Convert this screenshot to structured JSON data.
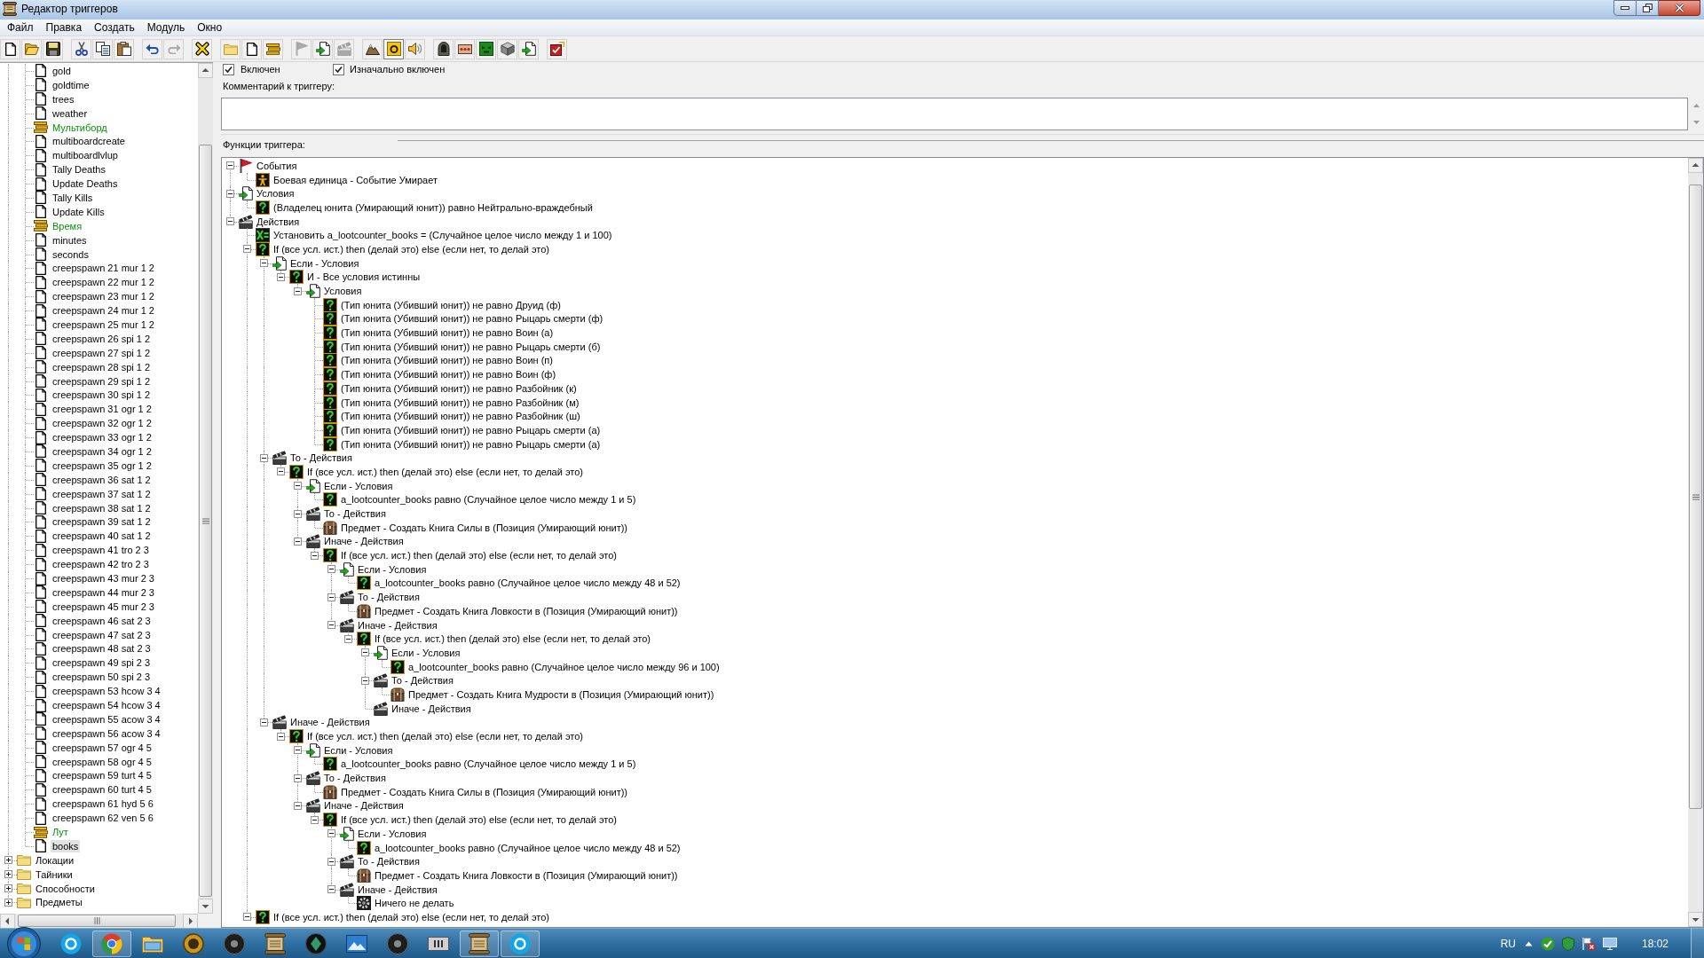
{
  "window": {
    "title": "Редактор триггеров"
  },
  "menu": [
    "Файл",
    "Правка",
    "Создать",
    "Модуль",
    "Окно"
  ],
  "toolbar": {
    "groups": [
      [
        {
          "kind": "new",
          "disabled": false,
          "pressed": false
        },
        {
          "kind": "open",
          "disabled": false,
          "pressed": false
        },
        {
          "kind": "save",
          "disabled": false,
          "pressed": false
        }
      ],
      [
        {
          "kind": "cut",
          "disabled": false,
          "pressed": false
        },
        {
          "kind": "copy",
          "disabled": false,
          "pressed": false
        },
        {
          "kind": "paste",
          "disabled": false,
          "pressed": false
        }
      ],
      [
        {
          "kind": "undo",
          "disabled": false,
          "pressed": false
        },
        {
          "kind": "redo",
          "disabled": true,
          "pressed": false
        }
      ],
      [
        {
          "kind": "delete",
          "disabled": false,
          "pressed": false
        }
      ],
      [
        {
          "kind": "new-category",
          "disabled": false,
          "pressed": false
        },
        {
          "kind": "new-trigger",
          "disabled": false,
          "pressed": false
        },
        {
          "kind": "new-comment",
          "disabled": false,
          "pressed": false
        }
      ],
      [
        {
          "kind": "new-event",
          "disabled": true,
          "pressed": false
        },
        {
          "kind": "new-condition",
          "disabled": false,
          "pressed": false
        },
        {
          "kind": "new-action",
          "disabled": true,
          "pressed": false
        }
      ],
      [
        {
          "kind": "terrain",
          "disabled": false,
          "pressed": false
        },
        {
          "kind": "object",
          "disabled": false,
          "pressed": true
        },
        {
          "kind": "sound",
          "disabled": false,
          "pressed": false
        }
      ],
      [
        {
          "kind": "unit",
          "disabled": false,
          "pressed": false
        },
        {
          "kind": "item",
          "disabled": false,
          "pressed": false
        },
        {
          "kind": "ai",
          "disabled": false,
          "pressed": false
        },
        {
          "kind": "import",
          "disabled": false,
          "pressed": false
        },
        {
          "kind": "manager",
          "disabled": false,
          "pressed": false
        }
      ],
      [
        {
          "kind": "test",
          "disabled": false,
          "pressed": false
        }
      ]
    ]
  },
  "sidebar": {
    "tree": [
      {
        "children": [
          {
            "kind": "trigger",
            "label": "gold",
            "selected": false
          },
          {
            "kind": "trigger",
            "label": "goldtime",
            "selected": false
          },
          {
            "kind": "trigger",
            "label": "trees",
            "selected": false
          },
          {
            "kind": "trigger",
            "label": "weather",
            "selected": false
          },
          {
            "kind": "category",
            "label": "Мультиборд",
            "selected": false
          },
          {
            "kind": "trigger",
            "label": "multiboardcreate",
            "selected": false
          },
          {
            "kind": "trigger",
            "label": "multiboardlvlup",
            "selected": false
          },
          {
            "kind": "trigger",
            "label": "Tally Deaths",
            "selected": false
          },
          {
            "kind": "trigger",
            "label": "Update Deaths",
            "selected": false
          },
          {
            "kind": "trigger",
            "label": "Tally Kills",
            "selected": false
          },
          {
            "kind": "trigger",
            "label": "Update Kills",
            "selected": false
          },
          {
            "kind": "category",
            "label": "Время",
            "selected": false
          },
          {
            "kind": "trigger",
            "label": "minutes",
            "selected": false
          },
          {
            "kind": "trigger",
            "label": "seconds",
            "selected": false
          },
          {
            "kind": "trigger",
            "label": "creepspawn 21 mur 1 2",
            "selected": false
          },
          {
            "kind": "trigger",
            "label": "creepspawn 22 mur 1 2",
            "selected": false
          },
          {
            "kind": "trigger",
            "label": "creepspawn 23 mur 1 2",
            "selected": false
          },
          {
            "kind": "trigger",
            "label": "creepspawn 24 mur 1 2",
            "selected": false
          },
          {
            "kind": "trigger",
            "label": "creepspawn 25 mur 1 2",
            "selected": false
          },
          {
            "kind": "trigger",
            "label": "creepspawn 26 spi 1 2",
            "selected": false
          },
          {
            "kind": "trigger",
            "label": "creepspawn 27 spi 1 2",
            "selected": false
          },
          {
            "kind": "trigger",
            "label": "creepspawn 28 spi 1 2",
            "selected": false
          },
          {
            "kind": "trigger",
            "label": "creepspawn 29 spi 1 2",
            "selected": false
          },
          {
            "kind": "trigger",
            "label": "creepspawn 30 spi 1 2",
            "selected": false
          },
          {
            "kind": "trigger",
            "label": "creepspawn 31 ogr 1 2",
            "selected": false
          },
          {
            "kind": "trigger",
            "label": "creepspawn 32 ogr 1 2",
            "selected": false
          },
          {
            "kind": "trigger",
            "label": "creepspawn 33 ogr 1 2",
            "selected": false
          },
          {
            "kind": "trigger",
            "label": "creepspawn 34 ogr 1 2",
            "selected": false
          },
          {
            "kind": "trigger",
            "label": "creepspawn 35 ogr 1 2",
            "selected": false
          },
          {
            "kind": "trigger",
            "label": "creepspawn 36 sat 1 2",
            "selected": false
          },
          {
            "kind": "trigger",
            "label": "creepspawn 37 sat 1 2",
            "selected": false
          },
          {
            "kind": "trigger",
            "label": "creepspawn 38 sat 1 2",
            "selected": false
          },
          {
            "kind": "trigger",
            "label": "creepspawn 39 sat 1 2",
            "selected": false
          },
          {
            "kind": "trigger",
            "label": "creepspawn 40 sat 1 2",
            "selected": false
          },
          {
            "kind": "trigger",
            "label": "creepspawn 41 tro 2 3",
            "selected": false
          },
          {
            "kind": "trigger",
            "label": "creepspawn 42 tro 2 3",
            "selected": false
          },
          {
            "kind": "trigger",
            "label": "creepspawn 43 mur 2 3",
            "selected": false
          },
          {
            "kind": "trigger",
            "label": "creepspawn 44 mur 2 3",
            "selected": false
          },
          {
            "kind": "trigger",
            "label": "creepspawn 45 mur 2 3",
            "selected": false
          },
          {
            "kind": "trigger",
            "label": "creepspawn 46 sat 2 3",
            "selected": false
          },
          {
            "kind": "trigger",
            "label": "creepspawn 47 sat 2 3",
            "selected": false
          },
          {
            "kind": "trigger",
            "label": "creepspawn 48 sat 2 3",
            "selected": false
          },
          {
            "kind": "trigger",
            "label": "creepspawn 49 spi 2 3",
            "selected": false
          },
          {
            "kind": "trigger",
            "label": "creepspawn 50 spi 2 3",
            "selected": false
          },
          {
            "kind": "trigger",
            "label": "creepspawn 53 hcow 3 4",
            "selected": false
          },
          {
            "kind": "trigger",
            "label": "creepspawn 54 hcow 3 4",
            "selected": false
          },
          {
            "kind": "trigger",
            "label": "creepspawn 55 acow 3 4",
            "selected": false
          },
          {
            "kind": "trigger",
            "label": "creepspawn 56 acow 3 4",
            "selected": false
          },
          {
            "kind": "trigger",
            "label": "creepspawn 57 ogr 4 5",
            "selected": false
          },
          {
            "kind": "trigger",
            "label": "creepspawn 58 ogr 4 5",
            "selected": false
          },
          {
            "kind": "trigger",
            "label": "creepspawn 59 turt 4 5",
            "selected": false
          },
          {
            "kind": "trigger",
            "label": "creepspawn 60 turt 4 5",
            "selected": false
          },
          {
            "kind": "trigger",
            "label": "creepspawn 61 hyd 5 6",
            "selected": false
          },
          {
            "kind": "trigger",
            "label": "creepspawn 62 ven 5 6",
            "selected": false
          },
          {
            "kind": "category",
            "label": "Лут",
            "selected": false
          },
          {
            "kind": "trigger",
            "label": "books",
            "selected": true
          }
        ]
      },
      {
        "kind": "folder",
        "label": "Локации",
        "expanded": false,
        "selected": false
      },
      {
        "kind": "folder",
        "label": "Тайники",
        "expanded": false,
        "selected": false
      },
      {
        "kind": "folder",
        "label": "Способности",
        "expanded": false,
        "selected": false
      },
      {
        "kind": "folder",
        "label": "Предметы",
        "expanded": false,
        "selected": false
      }
    ]
  },
  "trigger": {
    "enabled": {
      "label": "Включен",
      "checked": true
    },
    "initially_on": {
      "label": "Изначально включен",
      "checked": true
    },
    "comment": {
      "label": "Комментарий к триггеру:"
    },
    "functions": {
      "label": "Функции триггера:",
      "tree": [
        {
          "kind": "events",
          "label": "События",
          "expanded": true,
          "children": [
            {
              "kind": "unit-event",
              "label": "Боевая единица - Событие Умирает"
            }
          ]
        },
        {
          "kind": "conditions",
          "label": "Условия",
          "expanded": true,
          "children": [
            {
              "kind": "condition",
              "label": "(Владелец юнита (Умирающий юнит)) равно Нейтрально-враждебный"
            }
          ]
        },
        {
          "kind": "actions",
          "label": "Действия",
          "expanded": true,
          "children": [
            {
              "kind": "set-variable",
              "label": "Установить a_lootcounter_books = (Случайное целое число между 1 и 100)"
            },
            {
              "kind": "condition",
              "label": "If (все усл. ист.) then (делай это) else (если нет, то делай это)",
              "expanded": true,
              "children": [
                {
                  "kind": "conditions",
                  "label": "Если - Условия",
                  "expanded": true,
                  "children": [
                    {
                      "kind": "condition",
                      "label": "И - Все условия истинны",
                      "expanded": true,
                      "children": [
                        {
                          "kind": "conditions",
                          "label": "Условия",
                          "expanded": true,
                          "children": [
                            {
                              "kind": "condition",
                              "label": "(Тип юнита (Убивший юнит)) не равно Друид (ф)"
                            },
                            {
                              "kind": "condition",
                              "label": "(Тип юнита (Убивший юнит)) не равно Рыцарь смерти (ф)"
                            },
                            {
                              "kind": "condition",
                              "label": "(Тип юнита (Убивший юнит)) не равно Воин (а)"
                            },
                            {
                              "kind": "condition",
                              "label": "(Тип юнита (Убивший юнит)) не равно Рыцарь смерти (б)"
                            },
                            {
                              "kind": "condition",
                              "label": "(Тип юнита (Убивший юнит)) не равно Воин (п)"
                            },
                            {
                              "kind": "condition",
                              "label": "(Тип юнита (Убивший юнит)) не равно Воин (ф)"
                            },
                            {
                              "kind": "condition",
                              "label": "(Тип юнита (Убивший юнит)) не равно Разбойник (к)"
                            },
                            {
                              "kind": "condition",
                              "label": "(Тип юнита (Убивший юнит)) не равно Разбойник (м)"
                            },
                            {
                              "kind": "condition",
                              "label": "(Тип юнита (Убивший юнит)) не равно Разбойник (ш)"
                            },
                            {
                              "kind": "condition",
                              "label": "(Тип юнита (Убивший юнит)) не равно Рыцарь смерти (а)"
                            },
                            {
                              "kind": "condition",
                              "label": "(Тип юнита (Убивший юнит)) не равно Рыцарь смерти (а)"
                            }
                          ]
                        }
                      ]
                    }
                  ]
                },
                {
                  "kind": "actions",
                  "label": "То - Действия",
                  "expanded": true,
                  "children": [
                    {
                      "kind": "condition",
                      "label": "If (все усл. ист.) then (делай это) else (если нет, то делай это)",
                      "expanded": true,
                      "children": [
                        {
                          "kind": "conditions",
                          "label": "Если - Условия",
                          "expanded": true,
                          "children": [
                            {
                              "kind": "condition",
                              "label": "a_lootcounter_books равно (Случайное целое число между 1 и 5)"
                            }
                          ]
                        },
                        {
                          "kind": "actions",
                          "label": "То - Действия",
                          "expanded": true,
                          "children": [
                            {
                              "kind": "create-item",
                              "label": "Предмет - Создать Книга Силы в (Позиция (Умирающий юнит))"
                            }
                          ]
                        },
                        {
                          "kind": "actions",
                          "label": "Иначе - Действия",
                          "expanded": true,
                          "children": [
                            {
                              "kind": "condition",
                              "label": "If (все усл. ист.) then (делай это) else (если нет, то делай это)",
                              "expanded": true,
                              "children": [
                                {
                                  "kind": "conditions",
                                  "label": "Если - Условия",
                                  "expanded": true,
                                  "children": [
                                    {
                                      "kind": "condition",
                                      "label": "a_lootcounter_books равно (Случайное целое число между 48 и 52)"
                                    }
                                  ]
                                },
                                {
                                  "kind": "actions",
                                  "label": "То - Действия",
                                  "expanded": true,
                                  "children": [
                                    {
                                      "kind": "create-item",
                                      "label": "Предмет - Создать Книга Ловкости в (Позиция (Умирающий юнит))"
                                    }
                                  ]
                                },
                                {
                                  "kind": "actions",
                                  "label": "Иначе - Действия",
                                  "expanded": true,
                                  "children": [
                                    {
                                      "kind": "condition",
                                      "label": "If (все усл. ист.) then (делай это) else (если нет, то делай это)",
                                      "expanded": true,
                                      "children": [
                                        {
                                          "kind": "conditions",
                                          "label": "Если - Условия",
                                          "expanded": true,
                                          "children": [
                                            {
                                              "kind": "condition",
                                              "label": "a_lootcounter_books равно (Случайное целое число между 96 и 100)"
                                            }
                                          ]
                                        },
                                        {
                                          "kind": "actions",
                                          "label": "То - Действия",
                                          "expanded": true,
                                          "children": [
                                            {
                                              "kind": "create-item",
                                              "label": "Предмет - Создать Книга Мудрости в (Позиция (Умирающий юнит))"
                                            }
                                          ]
                                        },
                                        {
                                          "kind": "actions",
                                          "label": "Иначе - Действия"
                                        }
                                      ]
                                    }
                                  ]
                                }
                              ]
                            }
                          ]
                        }
                      ]
                    }
                  ]
                },
                {
                  "kind": "actions",
                  "label": "Иначе - Действия",
                  "expanded": true,
                  "children": [
                    {
                      "kind": "condition",
                      "label": "If (все усл. ист.) then (делай это) else (если нет, то делай это)",
                      "expanded": true,
                      "children": [
                        {
                          "kind": "conditions",
                          "label": "Если - Условия",
                          "expanded": true,
                          "children": [
                            {
                              "kind": "condition",
                              "label": "a_lootcounter_books равно (Случайное целое число между 1 и 5)"
                            }
                          ]
                        },
                        {
                          "kind": "actions",
                          "label": "То - Действия",
                          "expanded": true,
                          "children": [
                            {
                              "kind": "create-item",
                              "label": "Предмет - Создать Книга Силы в (Позиция (Умирающий юнит))"
                            }
                          ]
                        },
                        {
                          "kind": "actions",
                          "label": "Иначе - Действия",
                          "expanded": true,
                          "children": [
                            {
                              "kind": "condition",
                              "label": "If (все усл. ист.) then (делай это) else (если нет, то делай это)",
                              "expanded": true,
                              "children": [
                                {
                                  "kind": "conditions",
                                  "label": "Если - Условия",
                                  "expanded": true,
                                  "children": [
                                    {
                                      "kind": "condition",
                                      "label": "a_lootcounter_books равно (Случайное целое число между 48 и 52)"
                                    }
                                  ]
                                },
                                {
                                  "kind": "actions",
                                  "label": "То - Действия",
                                  "expanded": true,
                                  "children": [
                                    {
                                      "kind": "create-item",
                                      "label": "Предмет - Создать Книга Ловкости в (Позиция (Умирающий юнит))"
                                    }
                                  ]
                                },
                                {
                                  "kind": "actions",
                                  "label": "Иначе - Действия",
                                  "expanded": true,
                                  "children": [
                                    {
                                      "kind": "do-nothing",
                                      "label": "Ничего не делать"
                                    }
                                  ]
                                }
                              ]
                            }
                          ]
                        }
                      ]
                    }
                  ]
                }
              ]
            },
            {
              "kind": "condition",
              "label": "If (все усл. ист.) then (делай это) else (если нет, то делай это)",
              "expanded": true
            }
          ]
        }
      ]
    }
  },
  "taskbar": {
    "apps": [
      {
        "kind": "blue-disc",
        "running": false
      },
      {
        "kind": "ring",
        "running": true
      },
      {
        "kind": "folder",
        "running": false
      },
      {
        "kind": "gold-disc",
        "running": false
      },
      {
        "kind": "dark-disc",
        "running": false
      },
      {
        "kind": "scroll",
        "running": false
      },
      {
        "kind": "dark-emblem",
        "running": false
      },
      {
        "kind": "picture",
        "running": false
      },
      {
        "kind": "dark-disc",
        "running": false
      },
      {
        "kind": "bars",
        "running": false
      },
      {
        "kind": "scroll",
        "running": true
      },
      {
        "kind": "blue-disc",
        "running": true
      }
    ],
    "language": "RU",
    "clock": "18:02"
  }
}
